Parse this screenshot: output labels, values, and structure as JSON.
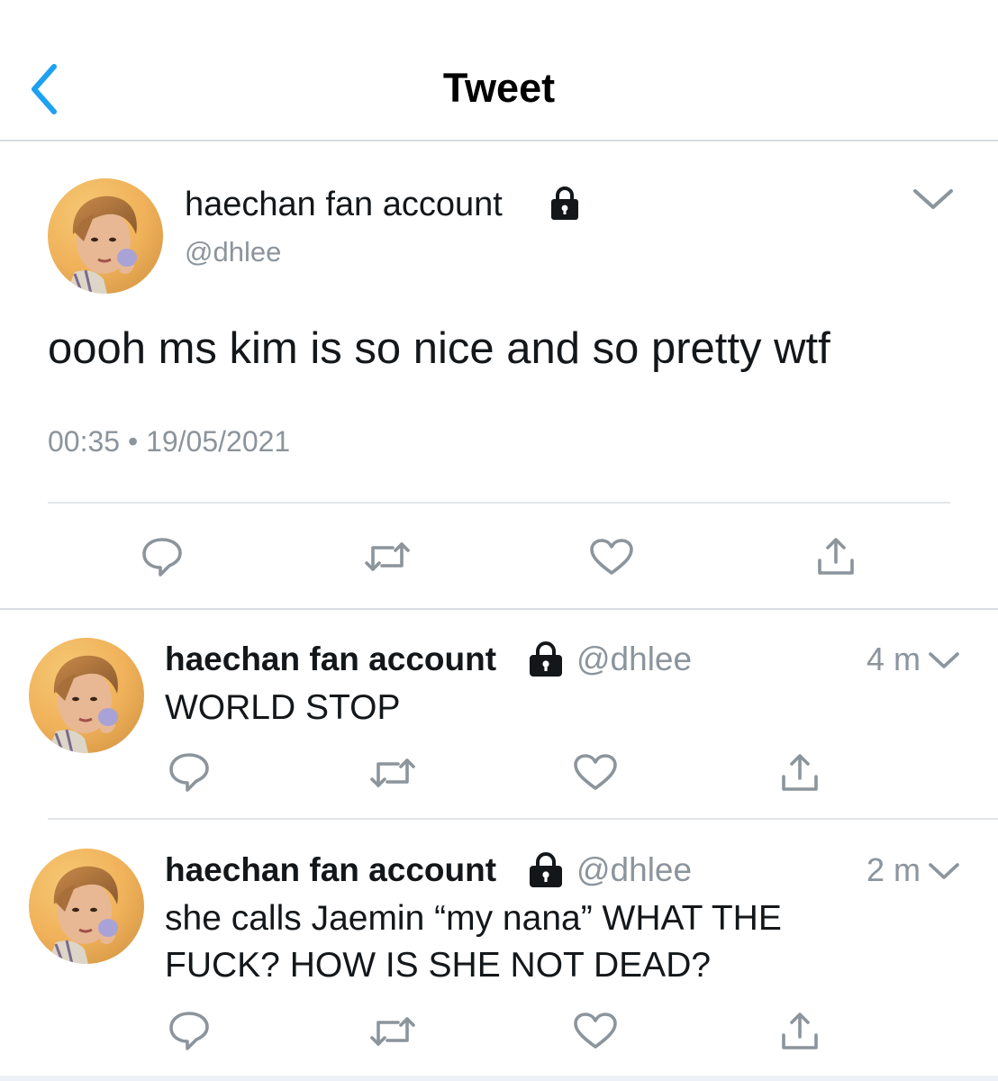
{
  "header": {
    "title": "Tweet"
  },
  "colors": {
    "accent": "#1da1f2",
    "text": "#14171a",
    "muted": "#8c949c",
    "divider": "#d9dde1"
  },
  "main_tweet": {
    "name": "haechan fan account",
    "handle": "@dhlee",
    "text": "oooh ms kim is so nice and so pretty wtf",
    "timestamp": "00:35 • 19/05/2021",
    "icons": [
      "reply-icon",
      "retweet-icon",
      "like-icon",
      "share-icon"
    ]
  },
  "replies": [
    {
      "name": "haechan fan account",
      "handle": "@dhlee",
      "time": "4 m",
      "text": "WORLD STOP"
    },
    {
      "name": "haechan fan account",
      "handle": "@dhlee",
      "time": "2 m",
      "text_line1": "she calls Jaemin “my nana” WHAT THE",
      "text_line2": "FUCK? HOW IS SHE NOT DEAD?"
    }
  ]
}
